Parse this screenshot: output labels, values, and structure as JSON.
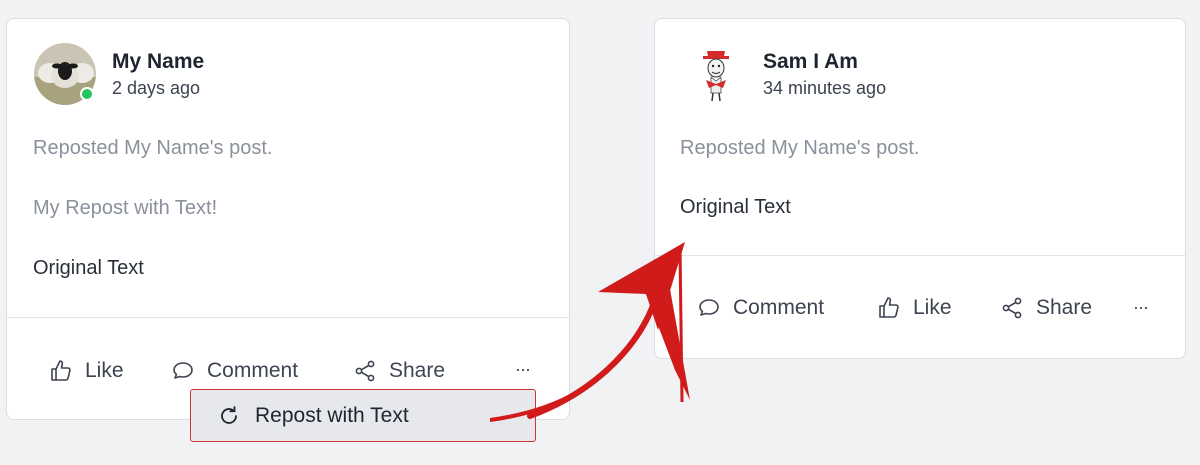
{
  "left_post": {
    "author_name": "My Name",
    "time": "2 days ago",
    "status": "online",
    "repost_note": "Reposted My Name's post.",
    "repost_text": "My Repost with Text!",
    "original_text": "Original Text",
    "actions": {
      "like": "Like",
      "comment": "Comment",
      "share": "Share",
      "more": "···"
    }
  },
  "repost_menu": {
    "label": "Repost with Text"
  },
  "right_post": {
    "author_name": "Sam I Am",
    "time": "34 minutes ago",
    "repost_note": "Reposted My Name's post.",
    "original_text": "Original Text",
    "actions": {
      "comment": "Comment",
      "like": "Like",
      "share": "Share",
      "more": "···"
    }
  },
  "colors": {
    "online": "#22c55e",
    "highlight_border": "#d63434",
    "arrow": "#d11a1a"
  }
}
